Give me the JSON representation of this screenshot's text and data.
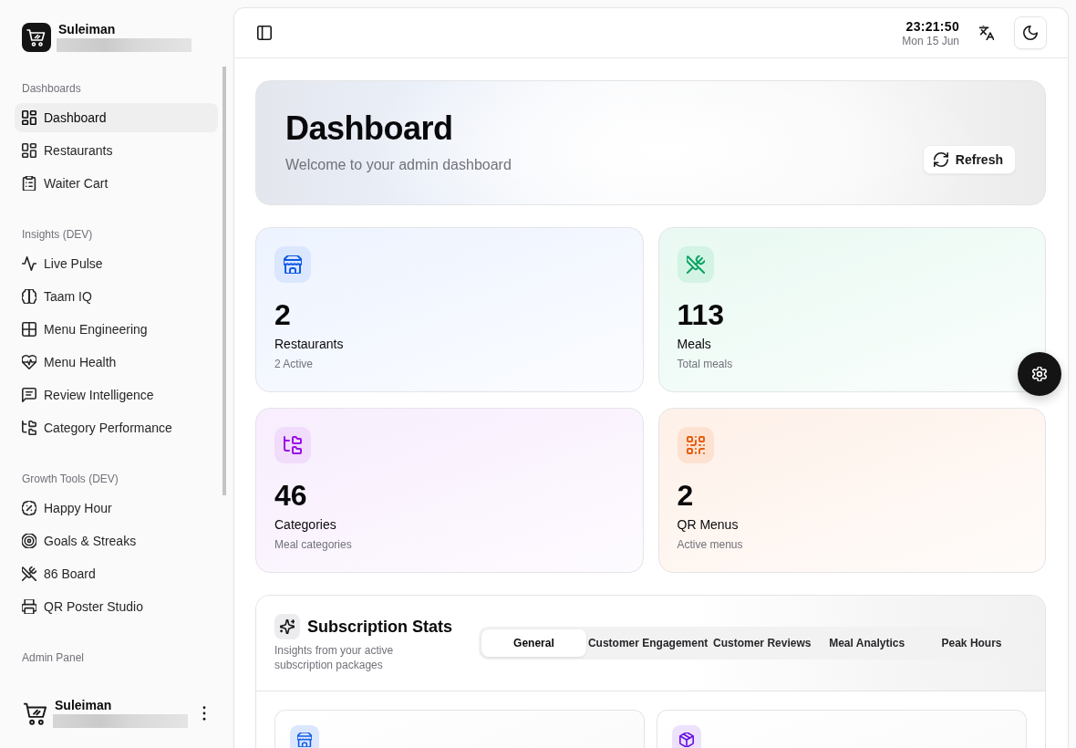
{
  "sidebar": {
    "brand": {
      "name": "Suleiman"
    },
    "sections": [
      {
        "label": "Dashboards",
        "items": [
          {
            "label": "Dashboard",
            "selected": true
          },
          {
            "label": "Restaurants",
            "selected": false
          },
          {
            "label": "Waiter Cart",
            "selected": false
          }
        ]
      },
      {
        "label": "Insights (DEV)",
        "items": [
          {
            "label": "Live Pulse",
            "selected": false
          },
          {
            "label": "Taam IQ",
            "selected": false
          },
          {
            "label": "Menu Engineering",
            "selected": false
          },
          {
            "label": "Menu Health",
            "selected": false
          },
          {
            "label": "Review Intelligence",
            "selected": false
          },
          {
            "label": "Category Performance",
            "selected": false
          }
        ]
      },
      {
        "label": "Growth Tools (DEV)",
        "items": [
          {
            "label": "Happy Hour",
            "selected": false
          },
          {
            "label": "Goals & Streaks",
            "selected": false
          },
          {
            "label": "86 Board",
            "selected": false
          },
          {
            "label": "QR Poster Studio",
            "selected": false
          }
        ]
      },
      {
        "label": "Admin Panel"
      }
    ],
    "user": {
      "name": "Suleiman"
    }
  },
  "header": {
    "time": "23:21:50",
    "date": "Mon 15 Jun"
  },
  "hero": {
    "title": "Dashboard",
    "subtitle": "Welcome to your admin dashboard",
    "refresh_button": "Refresh"
  },
  "stats": [
    {
      "value": "2",
      "label": "Restaurants",
      "note": "2 Active",
      "color": "#dbe7fe"
    },
    {
      "value": "113",
      "label": "Meals",
      "note": "Total meals",
      "color": "#d3f3e5"
    },
    {
      "value": "46",
      "label": "Categories",
      "note": "Meal categories",
      "color": "#f1dcfc"
    },
    {
      "value": "2",
      "label": "QR Menus",
      "note": "Active menus",
      "color": "#fde2d2"
    }
  ],
  "subscription": {
    "title": "Subscription Stats",
    "subtitle": "Insights from your active subscription packages",
    "tabs": [
      {
        "label": "General",
        "selected": true
      },
      {
        "label": "Customer Engagement",
        "selected": false
      },
      {
        "label": "Customer Reviews",
        "selected": false
      },
      {
        "label": "Meal Analytics",
        "selected": false
      },
      {
        "label": "Peak Hours",
        "selected": false
      }
    ],
    "cards": [
      {
        "color": "#dbe7fe"
      },
      {
        "color": "#ede2fd"
      }
    ]
  }
}
